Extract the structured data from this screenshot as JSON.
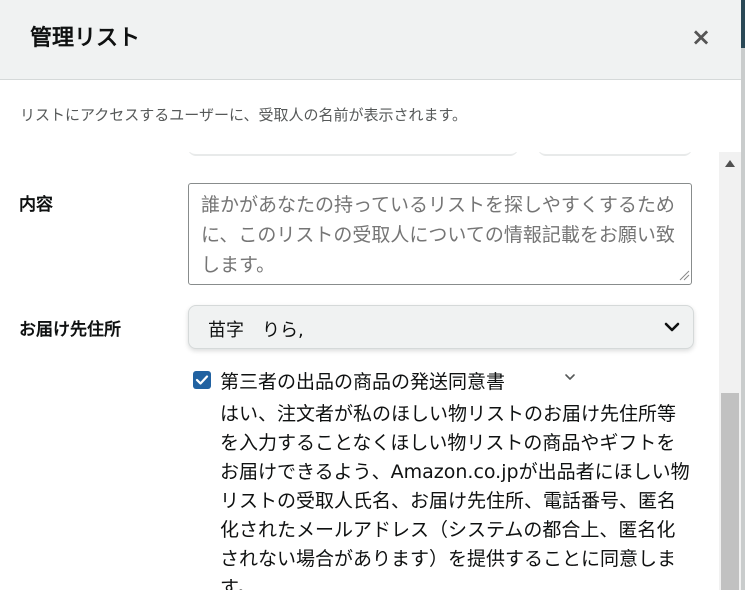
{
  "header": {
    "title": "管理リスト",
    "close_label": "×"
  },
  "notice": "リストにアクセスするユーザーに、受取人の名前が表示されます。",
  "form": {
    "content_label": "内容",
    "content_placeholder": "誰かがあなたの持っているリストを探しやすくするために、このリストの受取人についての情報記載をお願い致します。",
    "address_label": "お届け先住所",
    "address_value": "苗字　りら,",
    "consent": {
      "checked": true,
      "label": "第三者の出品の商品の発送同意書",
      "body": "はい、注文者が私のほしい物リストのお届け先住所等を入力することなくほしい物リストの商品やギフトをお届けできるよう、Amazon.co.jpが出品者にほしい物リストの受取人氏名、お届け先住所、電話番号、匿名化されたメールアドレス（システムの都合上、匿名化されない場合があります）を提供することに同意します。"
    }
  },
  "icons": {
    "close": "close-icon",
    "select_chevron": "chevron-down-icon",
    "consent_chevron": "chevron-down-icon",
    "check": "check-icon",
    "scroll_up": "scroll-up-arrow-icon"
  },
  "colors": {
    "header_bg": "#f0f2f2",
    "checkbox": "#2162a1",
    "text": "#0f1111",
    "muted": "#565959"
  }
}
